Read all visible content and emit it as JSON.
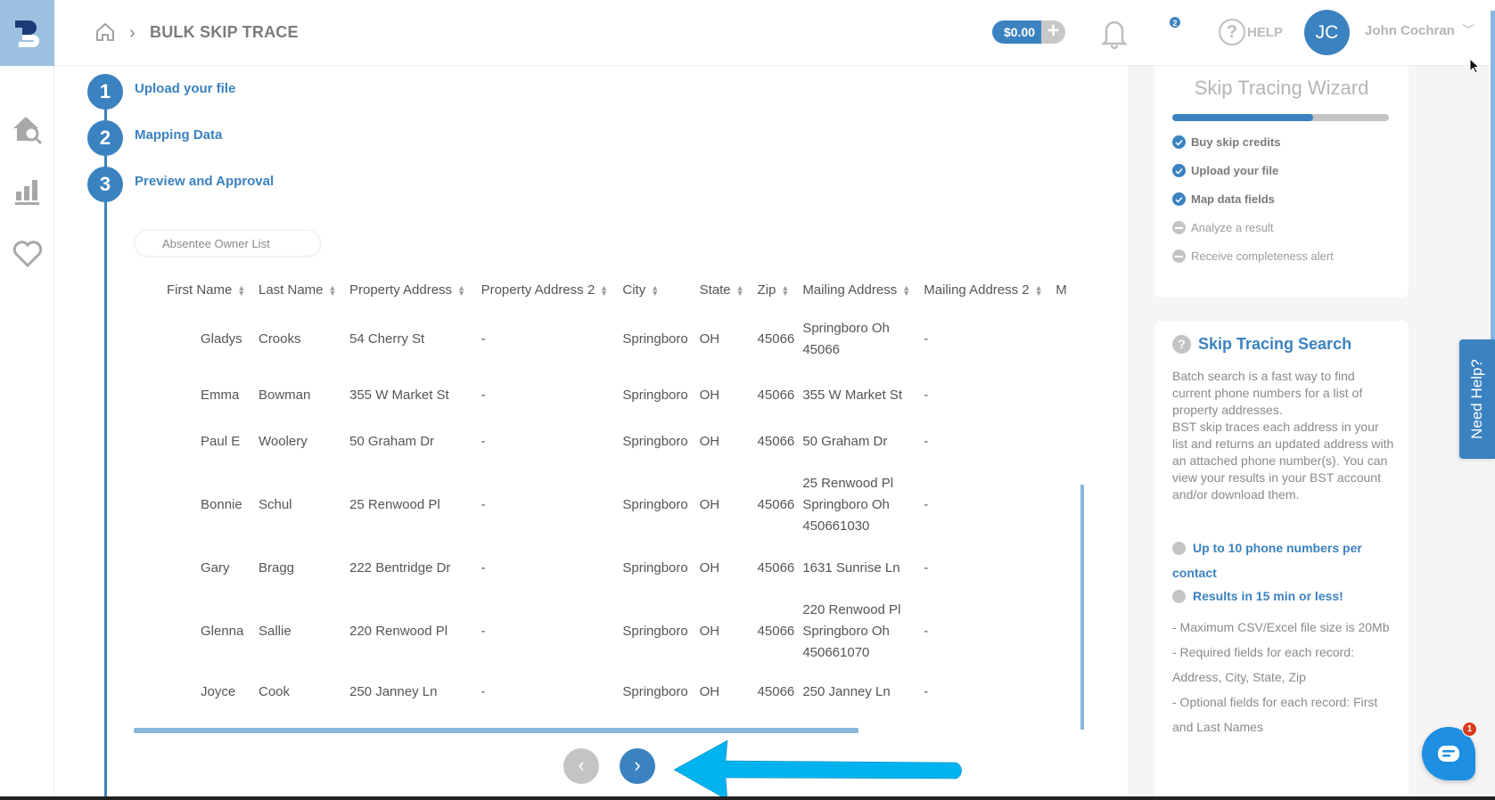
{
  "header": {
    "breadcrumb_title": "BULK SKIP TRACE",
    "balance": "$0.00",
    "balance_add": "+",
    "notifications_count": "2",
    "help_label": "HELP",
    "avatar_initials": "JC",
    "user_name": "John Cochran"
  },
  "rail": {
    "icons": [
      "home-search-icon",
      "bar-chart-icon",
      "heart-icon"
    ]
  },
  "steps": [
    {
      "number": "1",
      "label": "Upload your file"
    },
    {
      "number": "2",
      "label": "Mapping Data"
    },
    {
      "number": "3",
      "label": "Preview and Approval"
    }
  ],
  "list_name": {
    "value": "Absentee Owner List"
  },
  "table": {
    "columns": [
      "First Name",
      "Last Name",
      "Property Address",
      "Property Address 2",
      "City",
      "State",
      "Zip",
      "Mailing Address",
      "Mailing Address 2",
      "M"
    ],
    "rows": [
      [
        "Gladys",
        "Crooks",
        "54 Cherry St",
        "-",
        "Springboro",
        "OH",
        "45066",
        "Springboro Oh\n45066",
        "-"
      ],
      [
        "Emma",
        "Bowman",
        "355 W Market St",
        "-",
        "Springboro",
        "OH",
        "45066",
        "355 W Market St",
        "-"
      ],
      [
        "Paul E",
        "Woolery",
        "50 Graham Dr",
        "-",
        "Springboro",
        "OH",
        "45066",
        "50 Graham Dr",
        "-"
      ],
      [
        "Bonnie",
        "Schul",
        "25 Renwood Pl",
        "-",
        "Springboro",
        "OH",
        "45066",
        "25 Renwood Pl\nSpringboro Oh\n450661030",
        "-"
      ],
      [
        "Gary",
        "Bragg",
        "222 Bentridge Dr",
        "-",
        "Springboro",
        "OH",
        "45066",
        "1631 Sunrise Ln",
        "-"
      ],
      [
        "Glenna",
        "Sallie",
        "220 Renwood Pl",
        "-",
        "Springboro",
        "OH",
        "45066",
        "220 Renwood Pl\nSpringboro Oh\n450661070",
        "-"
      ],
      [
        "Joyce",
        "Cook",
        "250 Janney Ln",
        "-",
        "Springboro",
        "OH",
        "45066",
        "250 Janney Ln",
        "-"
      ]
    ]
  },
  "pager": {
    "prev": "‹",
    "next": "›"
  },
  "wizard": {
    "title": "Skip Tracing Wizard",
    "progress_percent": 65,
    "items": [
      {
        "label": "Buy skip credits",
        "done": true
      },
      {
        "label": "Upload your file",
        "done": true
      },
      {
        "label": "Map data fields",
        "done": true
      },
      {
        "label": "Analyze a result",
        "done": false
      },
      {
        "label": "Receive completeness alert",
        "done": false
      }
    ]
  },
  "info": {
    "title": "Skip Tracing Search",
    "body": "Batch search is a fast way to find current phone numbers for a list of property addresses.\nBST skip traces each address in your list and returns an updated address with an attached phone number(s). You can view your results in your BST account and/or download them.",
    "features": [
      "Up to 10 phone numbers per contact",
      "Results in 15 min or less!"
    ],
    "requirements": [
      "- Maximum CSV/Excel file size is 20Mb",
      "- Required fields for each record: Address, City, State, Zip",
      "- Optional fields for each record: First and Last Names"
    ]
  },
  "need_help": "Need Help?",
  "chat_badge": "1",
  "colors": {
    "primary": "#3b82c0",
    "logo_bg": "#9cc1e0",
    "arrow": "#00b3ef",
    "chat": "#1e8fe1",
    "badge_red": "#d93b1f"
  }
}
